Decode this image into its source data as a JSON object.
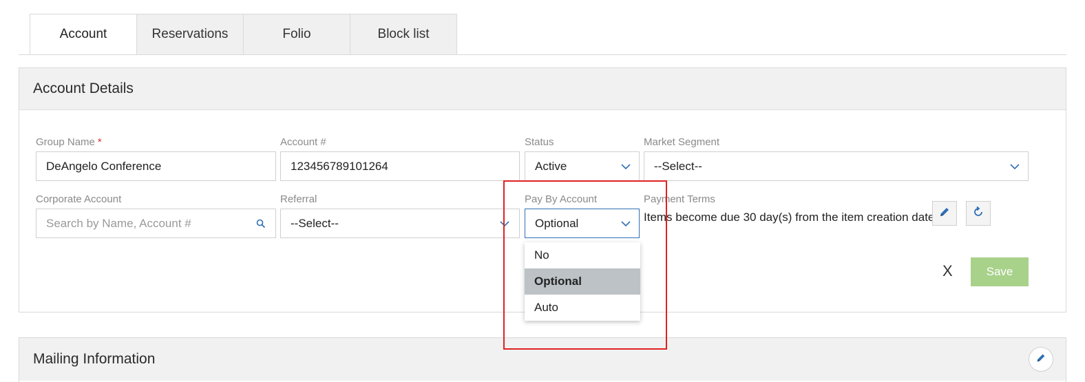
{
  "tabs": [
    {
      "label": "Account",
      "active": true
    },
    {
      "label": "Reservations",
      "active": false
    },
    {
      "label": "Folio",
      "active": false
    },
    {
      "label": "Block list",
      "active": false
    }
  ],
  "account_details": {
    "title": "Account Details",
    "group_name": {
      "label": "Group Name",
      "required_marker": "*",
      "value": "DeAngelo Conference"
    },
    "account_number": {
      "label": "Account #",
      "value": "123456789101264"
    },
    "status": {
      "label": "Status",
      "value": "Active"
    },
    "market_segment": {
      "label": "Market Segment",
      "value": "--Select--"
    },
    "corporate_account": {
      "label": "Corporate Account",
      "placeholder": "Search by Name, Account #"
    },
    "referral": {
      "label": "Referral",
      "value": "--Select--"
    },
    "pay_by_account": {
      "label": "Pay By Account",
      "value": "Optional",
      "options": [
        "No",
        "Optional",
        "Auto"
      ],
      "selected_option": "Optional"
    },
    "payment_terms": {
      "label": "Payment Terms",
      "text": "Items become due 30 day(s) from the item creation date"
    },
    "actions": {
      "cancel_label": "X",
      "save_label": "Save"
    }
  },
  "mailing_information": {
    "title": "Mailing Information"
  },
  "colors": {
    "accent": "#2f6fb3",
    "save_button": "#a8d18a",
    "selected_option_bg": "#bcc2c6",
    "highlight_border": "#e02020",
    "required": "#e03131"
  },
  "icons": {
    "chevron": "chevron-down-icon",
    "search": "search-icon",
    "edit": "pencil-icon",
    "refresh": "refresh-icon"
  }
}
